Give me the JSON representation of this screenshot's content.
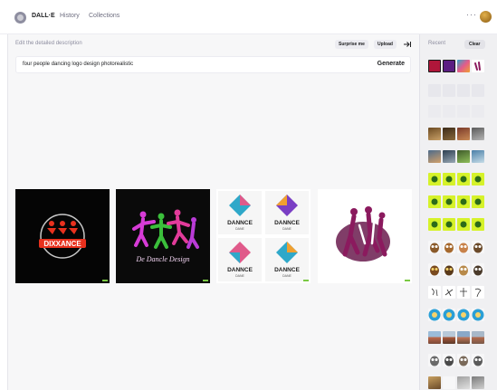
{
  "header": {
    "brand": "DALL·E",
    "nav": [
      "History",
      "Collections"
    ],
    "more_label": "···"
  },
  "editor": {
    "description_label": "Edit the detailed description",
    "surprise_label": "Surprise me",
    "upload_label": "Upload",
    "prompt_value": "four people dancing logo design photorealistic",
    "generate_label": "Generate"
  },
  "results": [
    {
      "text": "DIXXANCE"
    },
    {
      "text": "De Dancle Design"
    },
    {
      "text": "DANNCE",
      "sub": "DANE"
    },
    {
      "text": ""
    }
  ],
  "sidebar": {
    "recent_label": "Recent",
    "clear_label": "Clear"
  },
  "colors": {
    "accent_green": "#7ac943",
    "sidebar_bg": "#f0f0f2",
    "main_bg": "#f7f7f8"
  }
}
